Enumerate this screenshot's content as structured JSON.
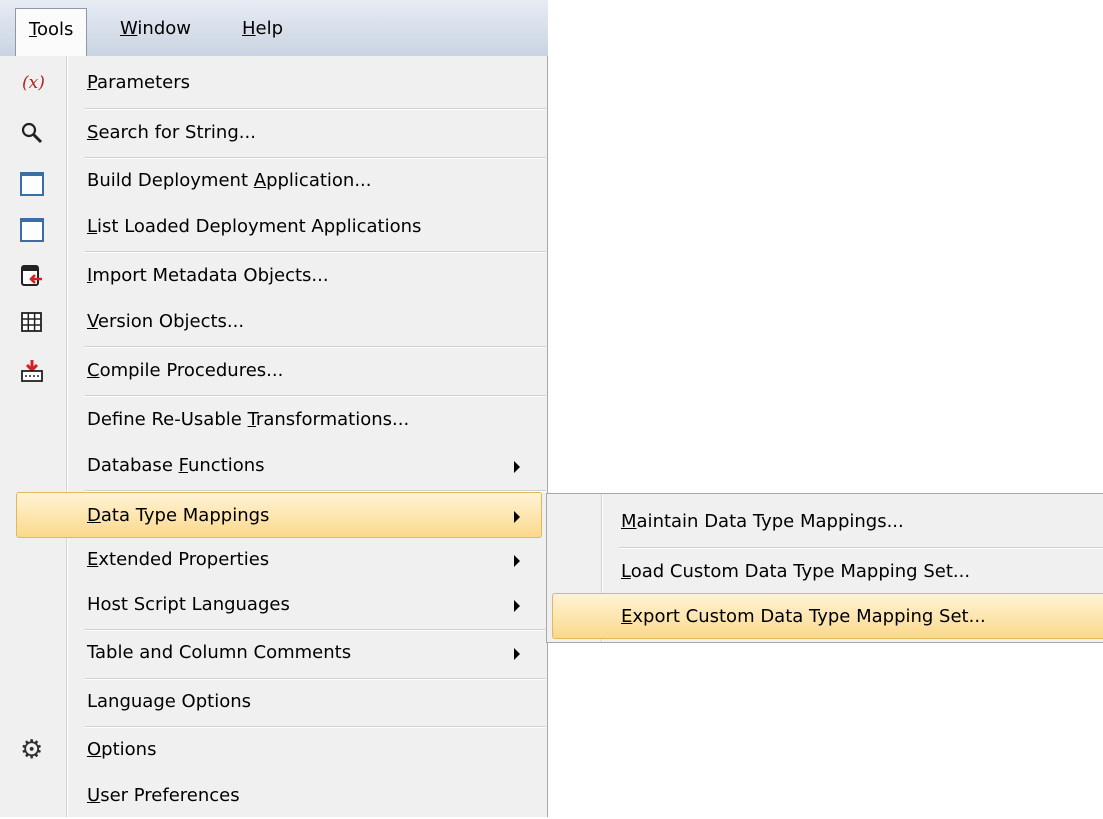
{
  "menubar": {
    "items": [
      {
        "pre": "",
        "ul": "T",
        "post": "ools"
      },
      {
        "pre": "",
        "ul": "W",
        "post": "indow"
      },
      {
        "pre": "",
        "ul": "H",
        "post": "elp"
      }
    ]
  },
  "tools_menu": {
    "items": [
      {
        "pre": "",
        "ul": "P",
        "post": "arameters",
        "icon": "parameters-icon",
        "icon_text": "(x)"
      },
      {
        "pre": "",
        "ul": "S",
        "post": "earch for String...",
        "icon": "search-icon"
      },
      {
        "pre": "Build Deployment ",
        "ul": "A",
        "post": "pplication...",
        "icon": "window-icon"
      },
      {
        "pre": "",
        "ul": "L",
        "post": "ist Loaded Deployment Applications",
        "icon": "window-icon"
      },
      {
        "pre": "",
        "ul": "I",
        "post": "mport Metadata Objects...",
        "icon": "import-icon"
      },
      {
        "pre": "",
        "ul": "V",
        "post": "ersion Objects...",
        "icon": "grid-icon"
      },
      {
        "pre": "",
        "ul": "C",
        "post": "ompile Procedures...",
        "icon": "compile-icon"
      },
      {
        "pre": "Define Re-Usable ",
        "ul": "T",
        "post": "ransformations..."
      },
      {
        "pre": "Database ",
        "ul": "F",
        "post": "unctions",
        "submenu": true
      },
      {
        "pre": "",
        "ul": "D",
        "post": "ata Type Mappings",
        "submenu": true,
        "highlighted": true
      },
      {
        "pre": "",
        "ul": "E",
        "post": "xtended Properties",
        "submenu": true
      },
      {
        "pre": "Host Script Languages",
        "ul": "",
        "post": "",
        "submenu": true
      },
      {
        "pre": "Table and Column Comments",
        "ul": "",
        "post": "",
        "submenu": true
      },
      {
        "pre": "Language Options",
        "ul": "",
        "post": ""
      },
      {
        "pre": "",
        "ul": "O",
        "post": "ptions",
        "icon": "gear-icon"
      },
      {
        "pre": "",
        "ul": "U",
        "post": "ser Preferences"
      }
    ]
  },
  "submenu": {
    "items": [
      {
        "pre": "",
        "ul": "M",
        "post": "aintain Data Type Mappings..."
      },
      {
        "pre": "",
        "ul": "L",
        "post": "oad Custom Data Type Mapping Set..."
      },
      {
        "pre": "",
        "ul": "E",
        "post": "xport Custom Data Type Mapping Set...",
        "highlighted": true
      }
    ]
  },
  "colors": {
    "highlight_top": "#fff3d6",
    "highlight_bottom": "#fbd98c",
    "menu_bg": "#f0f0f0",
    "menubar_bg": "#c9d3e1"
  }
}
